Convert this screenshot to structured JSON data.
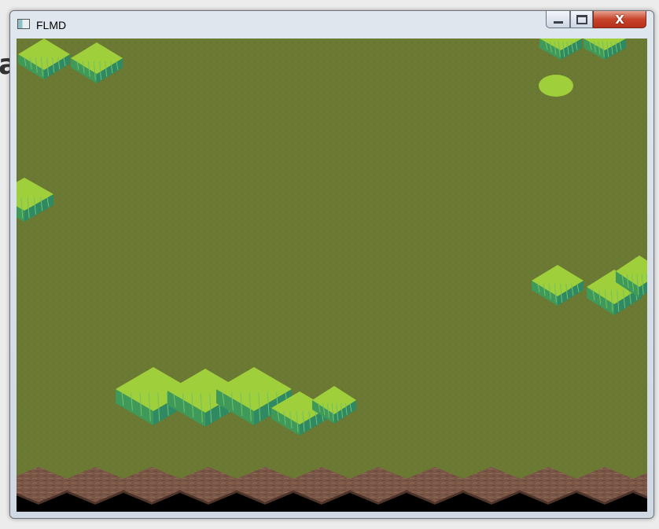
{
  "window": {
    "title": "FLMD",
    "controls": {
      "minimize_icon": "minimize-icon",
      "maximize_icon": "maximize-icon",
      "close_icon": "close-icon",
      "close_glyph": "X"
    }
  },
  "background": {
    "partial_letter": "a"
  },
  "scene": {
    "ground_color": "#6b7a33",
    "grass_top_color": "#9fcf3a",
    "grass_side_color": "#3f9a5a",
    "dirt_color": "#7a5646",
    "void_color": "#000000",
    "objects": [
      "grass-tile",
      "grass-tuft",
      "dirt-border"
    ]
  }
}
